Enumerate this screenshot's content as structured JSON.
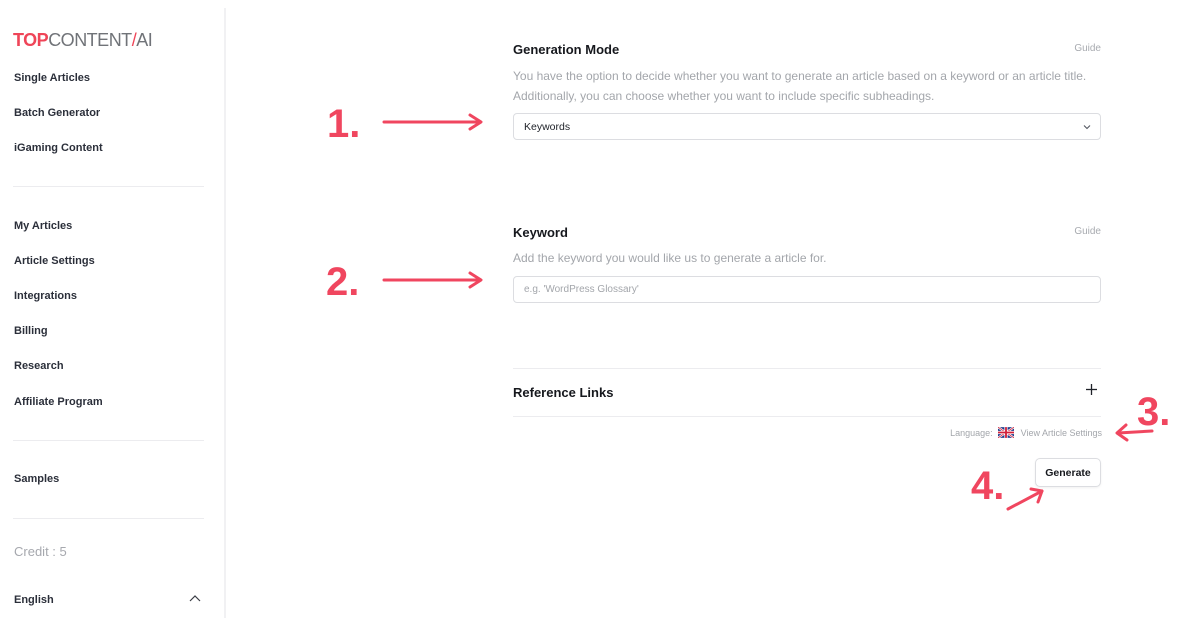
{
  "sidebar": {
    "logo": {
      "part1": "TOP",
      "part2": "CONTENT",
      "part3": "/",
      "part4": "AI"
    },
    "group1": [
      "Single Articles",
      "Batch Generator",
      "iGaming Content"
    ],
    "group2": [
      "My Articles",
      "Article Settings",
      "Integrations",
      "Billing",
      "Research",
      "Affiliate Program"
    ],
    "group3": [
      "Samples"
    ],
    "credit": "Credit : 5",
    "language": "English"
  },
  "main": {
    "generation_mode": {
      "title": "Generation Mode",
      "guide": "Guide",
      "description": "You have the option to decide whether you want to generate an article based on a keyword or an article title. Additionally, you can choose whether you want to include specific subheadings.",
      "selected": "Keywords"
    },
    "keyword": {
      "title": "Keyword",
      "guide": "Guide",
      "description": "Add the keyword you would like us to generate a article for.",
      "placeholder": "e.g. 'WordPress Glossary'",
      "value": ""
    },
    "reference_links": {
      "title": "Reference Links"
    },
    "language_row": {
      "label": "Language:",
      "flag": "uk-flag",
      "link": "View Article Settings"
    },
    "generate_label": "Generate"
  },
  "annotations": {
    "step1": "1.",
    "step2": "2.",
    "step3": "3.",
    "step4": "4.",
    "color": "#f0465f"
  },
  "colors": {
    "brand_red": "#ef4558",
    "text_dark": "#16181d",
    "text_muted": "#a3a6ab",
    "border": "#dcdde1"
  }
}
